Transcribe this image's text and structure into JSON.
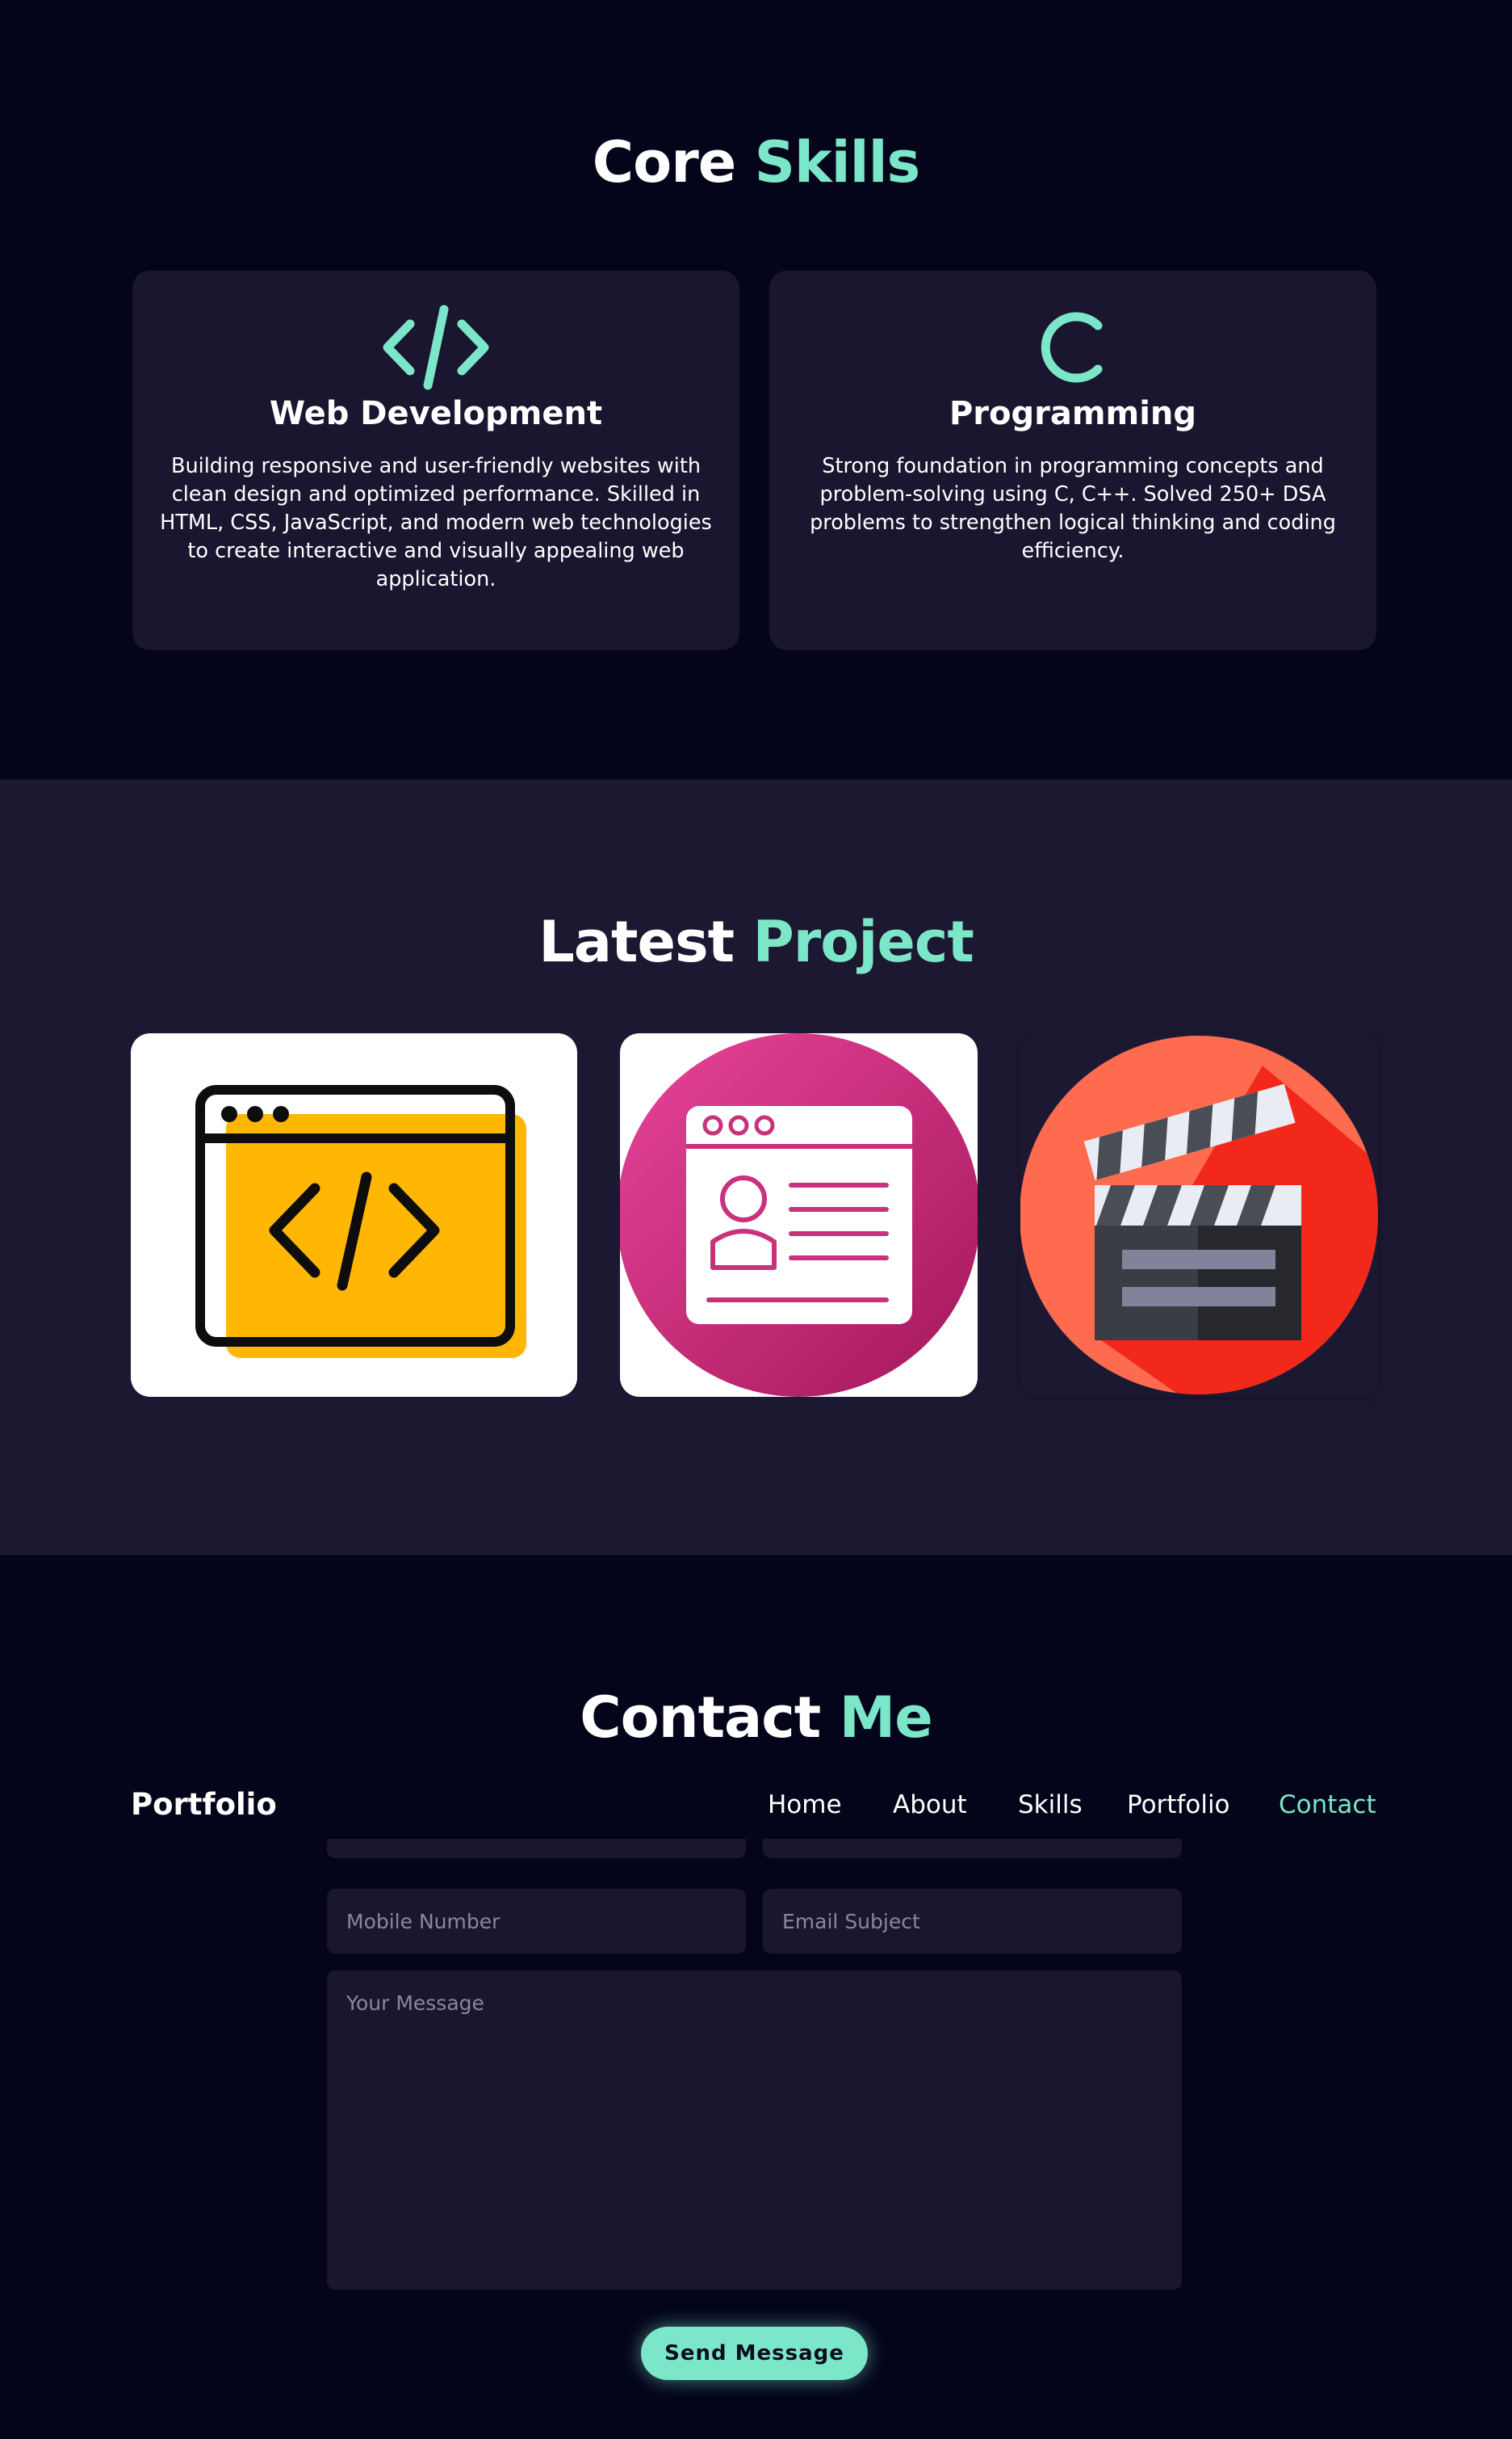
{
  "skills_section": {
    "heading_main": "Core",
    "heading_accent": "Skills",
    "cards": [
      {
        "icon": "code-icon",
        "title": "Web Development",
        "description": "Building responsive and user-friendly websites with clean design and optimized performance. Skilled in HTML, CSS, JavaScript, and modern web technologies to create interactive and visually appealing web application."
      },
      {
        "icon": "c-language-icon",
        "title": "Programming",
        "description": "Strong foundation in programming concepts and problem-solving using C, C++. Solved 250+ DSA problems to strengthen logical thinking and coding efficiency."
      }
    ]
  },
  "projects_section": {
    "heading_main": "Latest",
    "heading_accent": "Project",
    "projects": [
      {
        "image": "code-window-icon"
      },
      {
        "image": "profile-card-icon"
      },
      {
        "image": "clapperboard-icon"
      }
    ]
  },
  "contact_section": {
    "heading_main": "Contact",
    "heading_accent": "Me",
    "fields": {
      "mobile_placeholder": "Mobile Number",
      "subject_placeholder": "Email Subject",
      "message_placeholder": "Your Message"
    },
    "send_label": "Send Message"
  },
  "navbar": {
    "brand": "Portfolio",
    "links": [
      "Home",
      "About",
      "Skills",
      "Portfolio",
      "Contact"
    ],
    "active": "Contact"
  },
  "colors": {
    "background": "#04041a",
    "surface": "#1a1630",
    "section_alt": "#1d1832",
    "accent": "#7be6c8"
  }
}
